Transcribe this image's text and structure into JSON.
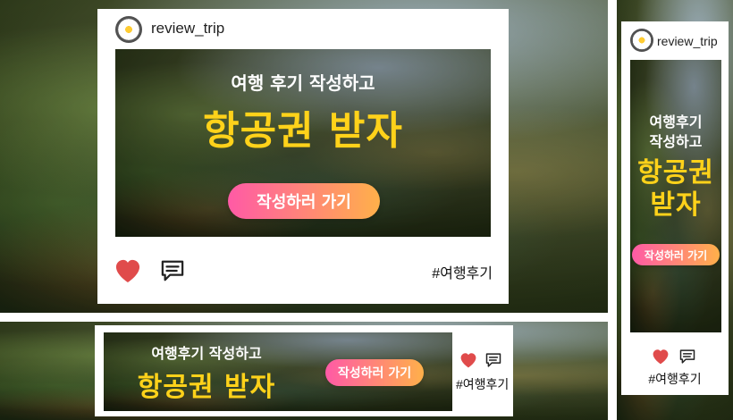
{
  "panels": {
    "large": {
      "username": "review_trip",
      "headline_small": "여행 후기 작성하고",
      "headline_big": "항공권 받자",
      "cta_label": "작성하러 가기",
      "hashtag": "#여행후기",
      "icons": {
        "like": "heart-icon",
        "comment": "comment-icon"
      }
    },
    "tall": {
      "username": "review_trip",
      "headline_small_line1": "여행후기",
      "headline_small_line2": "작성하고",
      "headline_big_line1": "항공권",
      "headline_big_line2": "받자",
      "cta_label": "작성하러 가기",
      "hashtag": "#여행후기",
      "icons": {
        "like": "heart-icon",
        "comment": "comment-icon"
      }
    },
    "wide": {
      "headline_small": "여행후기 작성하고",
      "headline_big": "항공권 받자",
      "cta_label": "작성하러 가기",
      "hashtag": "#여행후기",
      "icons": {
        "like": "heart-icon",
        "comment": "comment-icon"
      }
    }
  },
  "colors": {
    "headline_yellow": "#ffd21a",
    "cta_gradient_start": "#ff5aa6",
    "cta_gradient_end": "#ffb04a",
    "heart_red": "#e04b4b",
    "card_bg": "#ffffff"
  }
}
